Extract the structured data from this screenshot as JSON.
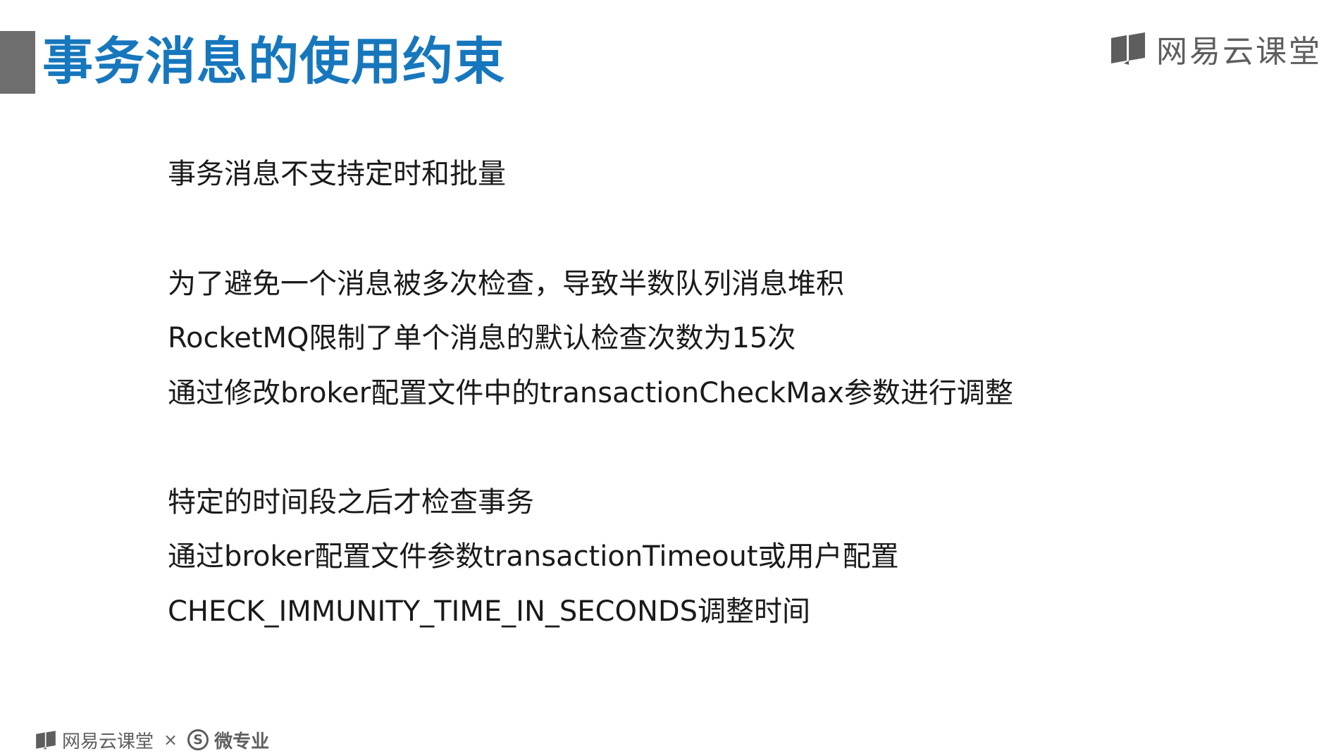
{
  "slide": {
    "title": "事务消息的使用约束",
    "brand": "网易云课堂",
    "lines": [
      "事务消息不支持定时和批量",
      "为了避免一个消息被多次检查，导致半数队列消息堆积",
      "RocketMQ限制了单个消息的默认检查次数为15次",
      "通过修改broker配置文件中的transactionCheckMax参数进行调整",
      "特定的时间段之后才检查事务",
      "通过broker配置文件参数transactionTimeout或用户配置",
      "CHECK_IMMUNITY_TIME_IN_SECONDS调整时间"
    ]
  },
  "footer": {
    "brand": "网易云课堂",
    "separator": "×",
    "badge": "S",
    "partner": "微专业"
  },
  "colors": {
    "title": "#1677bd",
    "title_bar": "#6e6e6e",
    "text": "#1a1a1a",
    "brand": "#5e5e5e"
  }
}
